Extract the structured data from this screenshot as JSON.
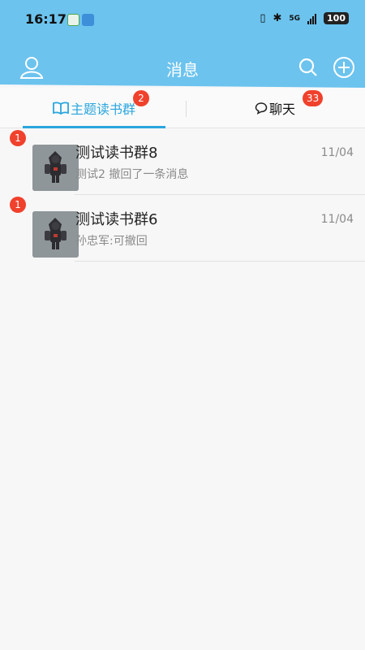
{
  "status_bar": {
    "time": "16:17",
    "network": "5G",
    "battery": "100"
  },
  "nav": {
    "title": "消息",
    "profile_icon": "person-icon",
    "search_icon": "search-icon",
    "add_icon": "plus-circle-icon"
  },
  "tabs": [
    {
      "label": "主题读书群",
      "icon": "book-icon",
      "badge": "2",
      "active": true
    },
    {
      "label": "聊天",
      "icon": "chat-bubble-icon",
      "badge": "33",
      "active": false
    }
  ],
  "conversations": [
    {
      "title": "测试读书群8",
      "last_message": "测试2 撤回了一条消息",
      "time": "11/04",
      "unread": "1"
    },
    {
      "title": "测试读书群6",
      "last_message": "孙忠军:可撤回",
      "time": "11/04",
      "unread": "1"
    }
  ],
  "colors": {
    "header": "#6cc3ee",
    "accent": "#2aa6de",
    "badge": "#f0412d"
  }
}
